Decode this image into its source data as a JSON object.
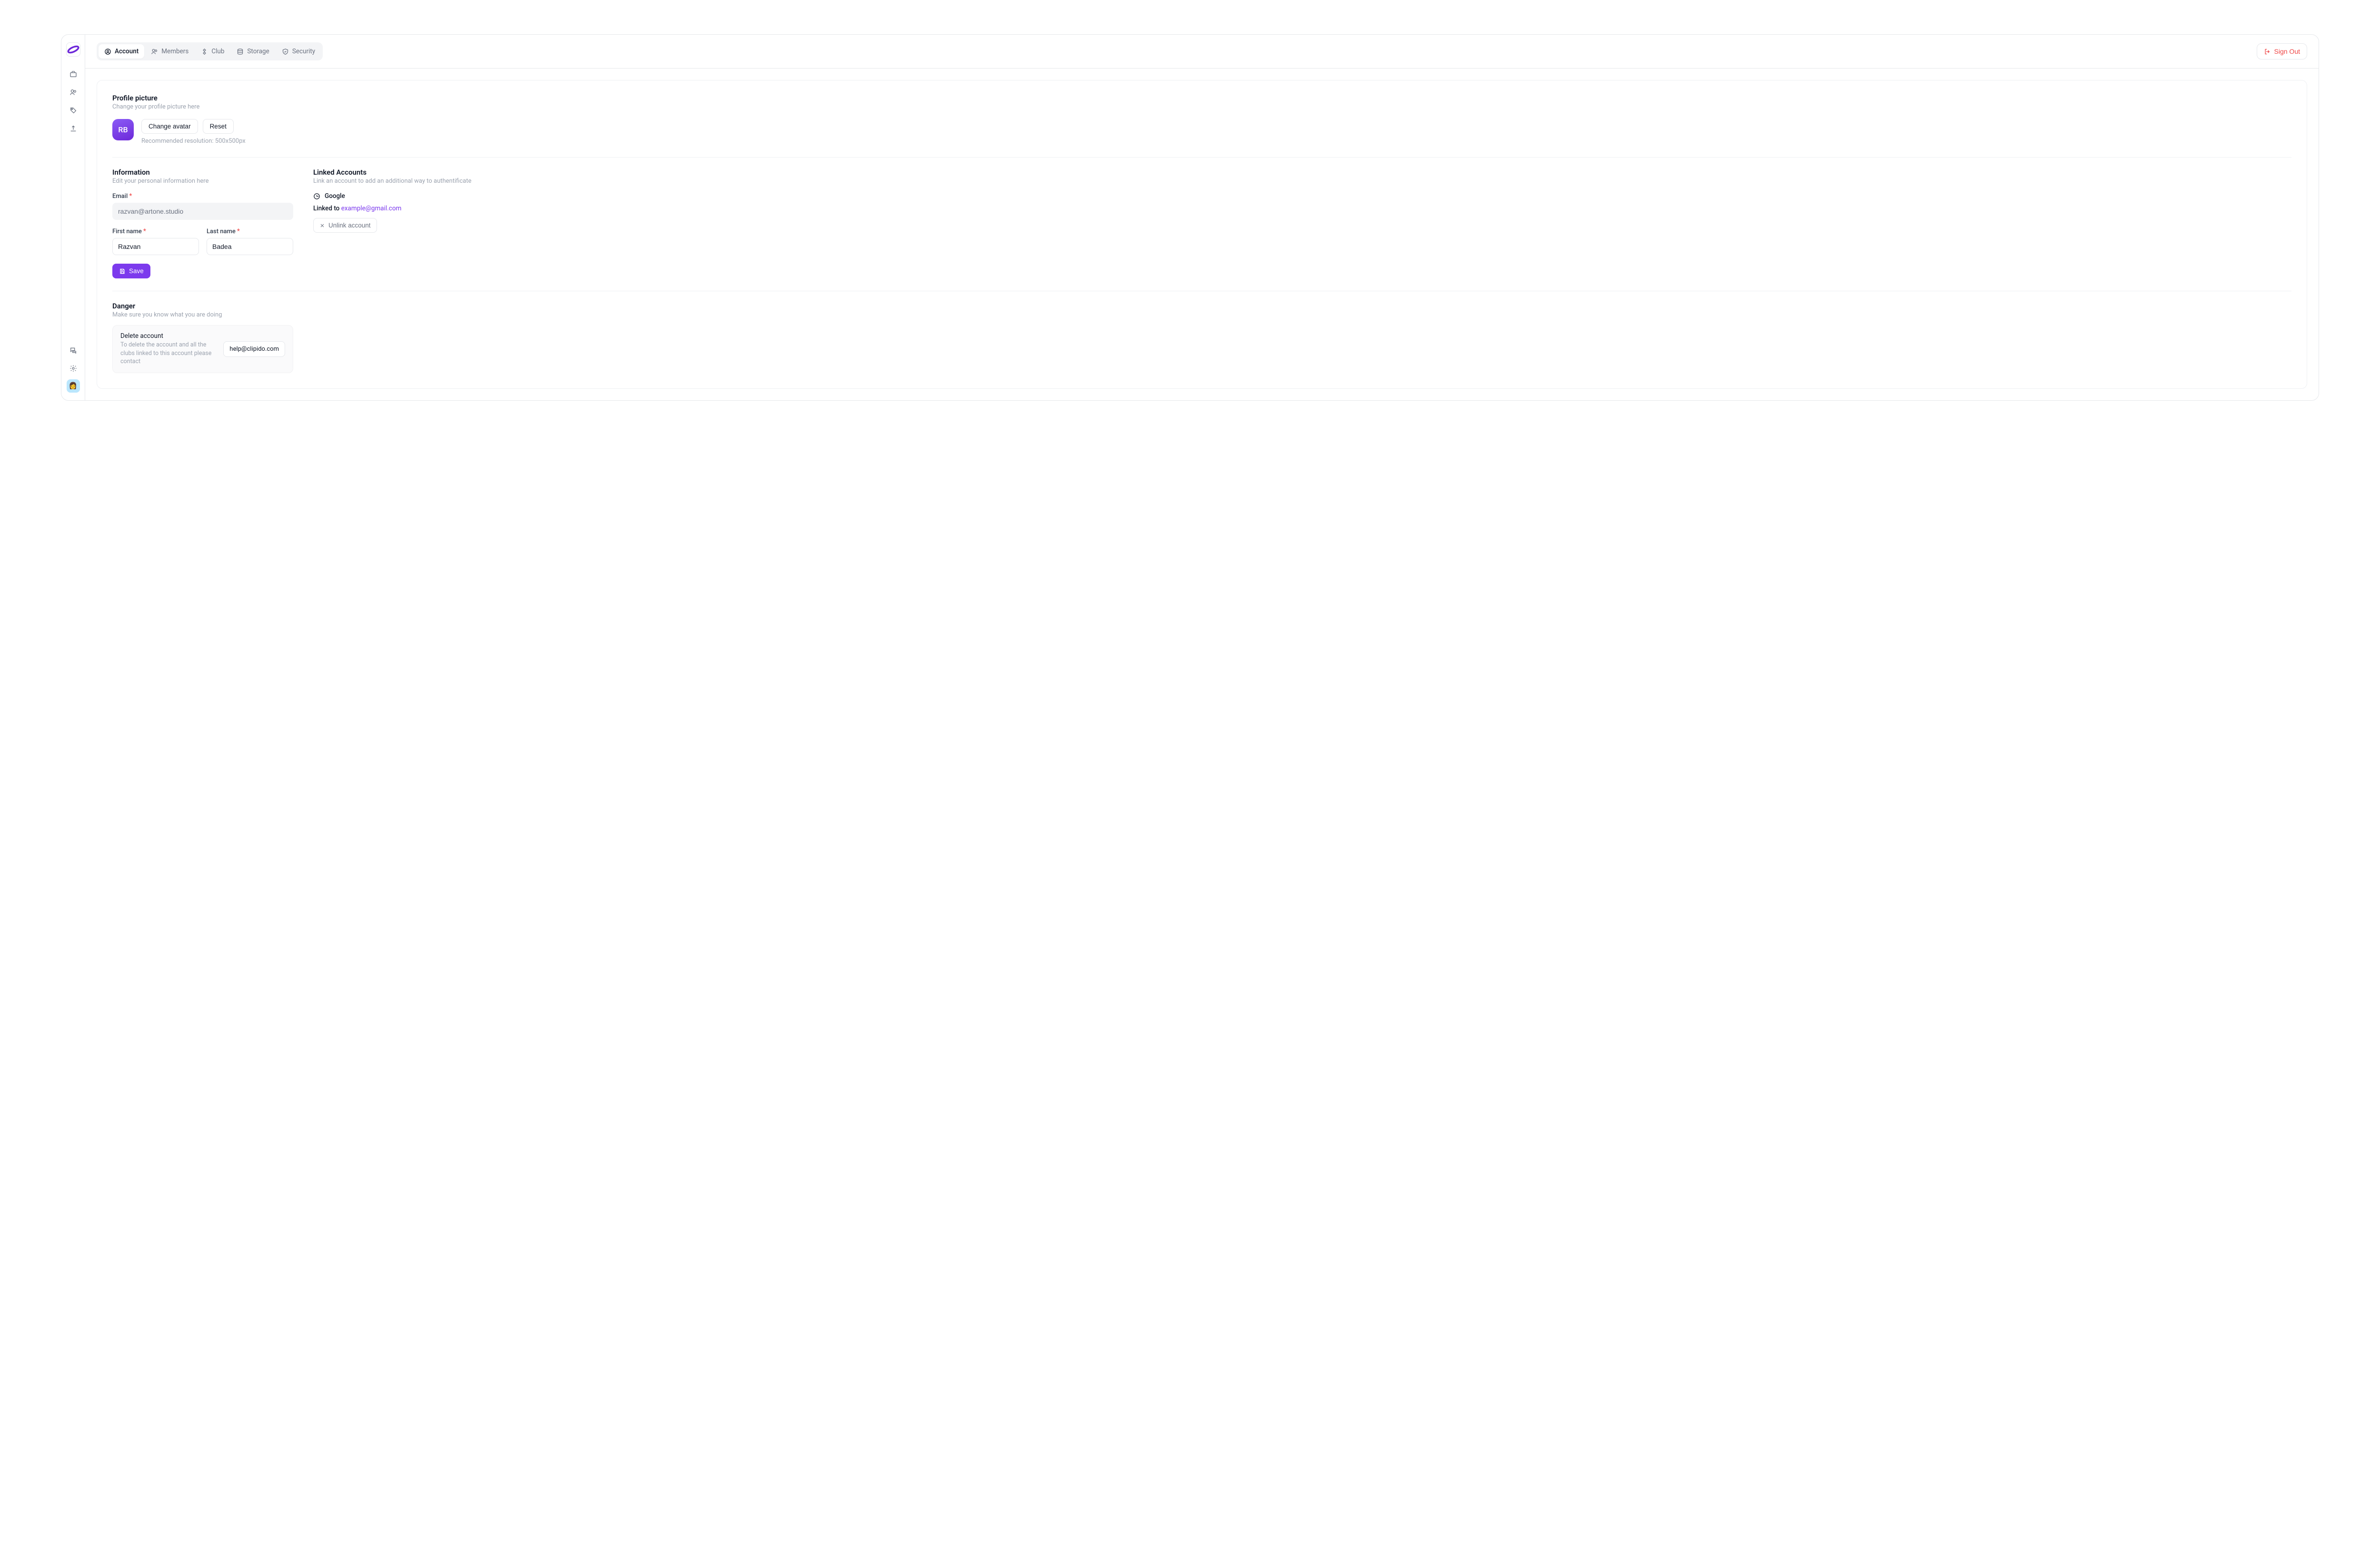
{
  "tabs": [
    {
      "id": "account",
      "label": "Account",
      "icon": "user-circle",
      "active": true
    },
    {
      "id": "members",
      "label": "Members",
      "icon": "users"
    },
    {
      "id": "club",
      "label": "Club",
      "icon": "diamond"
    },
    {
      "id": "storage",
      "label": "Storage",
      "icon": "database"
    },
    {
      "id": "security",
      "label": "Security",
      "icon": "shield"
    }
  ],
  "signout_label": "Sign Out",
  "profile": {
    "title": "Profile picture",
    "subtitle": "Change your profile picture here",
    "avatar_initials": "RB",
    "change_label": "Change avatar",
    "reset_label": "Reset",
    "hint": "Recommended resolution: 500x500px"
  },
  "info": {
    "title": "Information",
    "subtitle": "Edit your personal information here",
    "email_label": "Email",
    "email_value": "razvan@artone.studio",
    "first_label": "First name",
    "first_value": "Razvan",
    "last_label": "Last name",
    "last_value": "Badea",
    "save_label": "Save"
  },
  "linked": {
    "title": "Linked Accounts",
    "subtitle": "Link an account to add an additional way to authentificate",
    "provider": "Google",
    "linked_prefix": "Linked to ",
    "linked_email": "example@gmail.com",
    "unlink_label": "Unlink account"
  },
  "danger": {
    "title": "Danger",
    "subtitle": "Make sure you know what you are doing",
    "row_title": "Delete account",
    "row_body": "To delete the account and all the clubs linked to this account please contact",
    "help_email": "help@clipido.com"
  },
  "sidebar_avatar_emoji": "👩"
}
